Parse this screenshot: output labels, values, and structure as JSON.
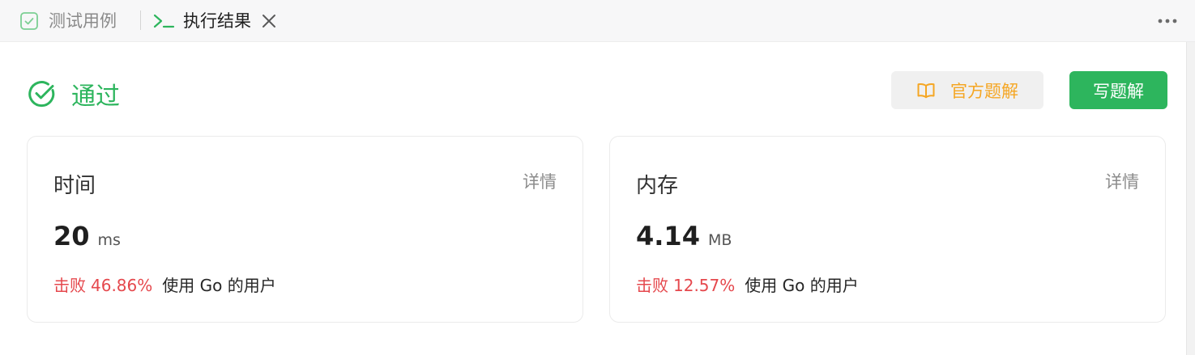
{
  "tabs": {
    "testcase_label": "测试用例",
    "result_label": "执行结果"
  },
  "status": {
    "label": "通过",
    "color": "#2db55d"
  },
  "actions": {
    "editorial_label": "官方题解",
    "solution_label": "写题解"
  },
  "time_card": {
    "title": "时间",
    "detail": "详情",
    "value": "20",
    "unit": "ms",
    "beats_label": "击败",
    "beats_percent": "46.86%",
    "beats_suffix": "使用 Go 的用户"
  },
  "memory_card": {
    "title": "内存",
    "detail": "详情",
    "value": "4.14",
    "unit": "MB",
    "beats_label": "击败",
    "beats_percent": "12.57%",
    "beats_suffix": "使用 Go 的用户"
  },
  "colors": {
    "accent_green": "#2db55d",
    "editorial_orange": "#f5a623",
    "beats_red": "#e5484d"
  },
  "icons": [
    "checkbox-icon",
    "terminal-icon",
    "close-icon",
    "more-icon",
    "check-circle-icon",
    "book-icon"
  ]
}
